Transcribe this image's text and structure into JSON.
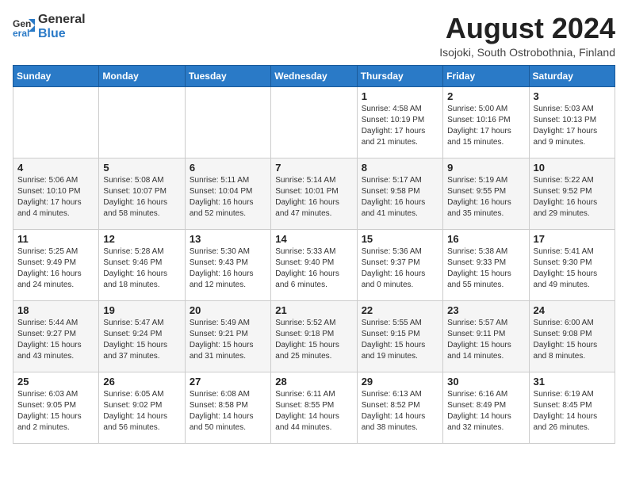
{
  "logo": {
    "line1": "General",
    "line2": "Blue"
  },
  "title": "August 2024",
  "location": "Isojoki, South Ostrobothnia, Finland",
  "weekdays": [
    "Sunday",
    "Monday",
    "Tuesday",
    "Wednesday",
    "Thursday",
    "Friday",
    "Saturday"
  ],
  "weeks": [
    [
      {
        "day": "",
        "info": ""
      },
      {
        "day": "",
        "info": ""
      },
      {
        "day": "",
        "info": ""
      },
      {
        "day": "",
        "info": ""
      },
      {
        "day": "1",
        "info": "Sunrise: 4:58 AM\nSunset: 10:19 PM\nDaylight: 17 hours\nand 21 minutes."
      },
      {
        "day": "2",
        "info": "Sunrise: 5:00 AM\nSunset: 10:16 PM\nDaylight: 17 hours\nand 15 minutes."
      },
      {
        "day": "3",
        "info": "Sunrise: 5:03 AM\nSunset: 10:13 PM\nDaylight: 17 hours\nand 9 minutes."
      }
    ],
    [
      {
        "day": "4",
        "info": "Sunrise: 5:06 AM\nSunset: 10:10 PM\nDaylight: 17 hours\nand 4 minutes."
      },
      {
        "day": "5",
        "info": "Sunrise: 5:08 AM\nSunset: 10:07 PM\nDaylight: 16 hours\nand 58 minutes."
      },
      {
        "day": "6",
        "info": "Sunrise: 5:11 AM\nSunset: 10:04 PM\nDaylight: 16 hours\nand 52 minutes."
      },
      {
        "day": "7",
        "info": "Sunrise: 5:14 AM\nSunset: 10:01 PM\nDaylight: 16 hours\nand 47 minutes."
      },
      {
        "day": "8",
        "info": "Sunrise: 5:17 AM\nSunset: 9:58 PM\nDaylight: 16 hours\nand 41 minutes."
      },
      {
        "day": "9",
        "info": "Sunrise: 5:19 AM\nSunset: 9:55 PM\nDaylight: 16 hours\nand 35 minutes."
      },
      {
        "day": "10",
        "info": "Sunrise: 5:22 AM\nSunset: 9:52 PM\nDaylight: 16 hours\nand 29 minutes."
      }
    ],
    [
      {
        "day": "11",
        "info": "Sunrise: 5:25 AM\nSunset: 9:49 PM\nDaylight: 16 hours\nand 24 minutes."
      },
      {
        "day": "12",
        "info": "Sunrise: 5:28 AM\nSunset: 9:46 PM\nDaylight: 16 hours\nand 18 minutes."
      },
      {
        "day": "13",
        "info": "Sunrise: 5:30 AM\nSunset: 9:43 PM\nDaylight: 16 hours\nand 12 minutes."
      },
      {
        "day": "14",
        "info": "Sunrise: 5:33 AM\nSunset: 9:40 PM\nDaylight: 16 hours\nand 6 minutes."
      },
      {
        "day": "15",
        "info": "Sunrise: 5:36 AM\nSunset: 9:37 PM\nDaylight: 16 hours\nand 0 minutes."
      },
      {
        "day": "16",
        "info": "Sunrise: 5:38 AM\nSunset: 9:33 PM\nDaylight: 15 hours\nand 55 minutes."
      },
      {
        "day": "17",
        "info": "Sunrise: 5:41 AM\nSunset: 9:30 PM\nDaylight: 15 hours\nand 49 minutes."
      }
    ],
    [
      {
        "day": "18",
        "info": "Sunrise: 5:44 AM\nSunset: 9:27 PM\nDaylight: 15 hours\nand 43 minutes."
      },
      {
        "day": "19",
        "info": "Sunrise: 5:47 AM\nSunset: 9:24 PM\nDaylight: 15 hours\nand 37 minutes."
      },
      {
        "day": "20",
        "info": "Sunrise: 5:49 AM\nSunset: 9:21 PM\nDaylight: 15 hours\nand 31 minutes."
      },
      {
        "day": "21",
        "info": "Sunrise: 5:52 AM\nSunset: 9:18 PM\nDaylight: 15 hours\nand 25 minutes."
      },
      {
        "day": "22",
        "info": "Sunrise: 5:55 AM\nSunset: 9:15 PM\nDaylight: 15 hours\nand 19 minutes."
      },
      {
        "day": "23",
        "info": "Sunrise: 5:57 AM\nSunset: 9:11 PM\nDaylight: 15 hours\nand 14 minutes."
      },
      {
        "day": "24",
        "info": "Sunrise: 6:00 AM\nSunset: 9:08 PM\nDaylight: 15 hours\nand 8 minutes."
      }
    ],
    [
      {
        "day": "25",
        "info": "Sunrise: 6:03 AM\nSunset: 9:05 PM\nDaylight: 15 hours\nand 2 minutes."
      },
      {
        "day": "26",
        "info": "Sunrise: 6:05 AM\nSunset: 9:02 PM\nDaylight: 14 hours\nand 56 minutes."
      },
      {
        "day": "27",
        "info": "Sunrise: 6:08 AM\nSunset: 8:58 PM\nDaylight: 14 hours\nand 50 minutes."
      },
      {
        "day": "28",
        "info": "Sunrise: 6:11 AM\nSunset: 8:55 PM\nDaylight: 14 hours\nand 44 minutes."
      },
      {
        "day": "29",
        "info": "Sunrise: 6:13 AM\nSunset: 8:52 PM\nDaylight: 14 hours\nand 38 minutes."
      },
      {
        "day": "30",
        "info": "Sunrise: 6:16 AM\nSunset: 8:49 PM\nDaylight: 14 hours\nand 32 minutes."
      },
      {
        "day": "31",
        "info": "Sunrise: 6:19 AM\nSunset: 8:45 PM\nDaylight: 14 hours\nand 26 minutes."
      }
    ]
  ]
}
